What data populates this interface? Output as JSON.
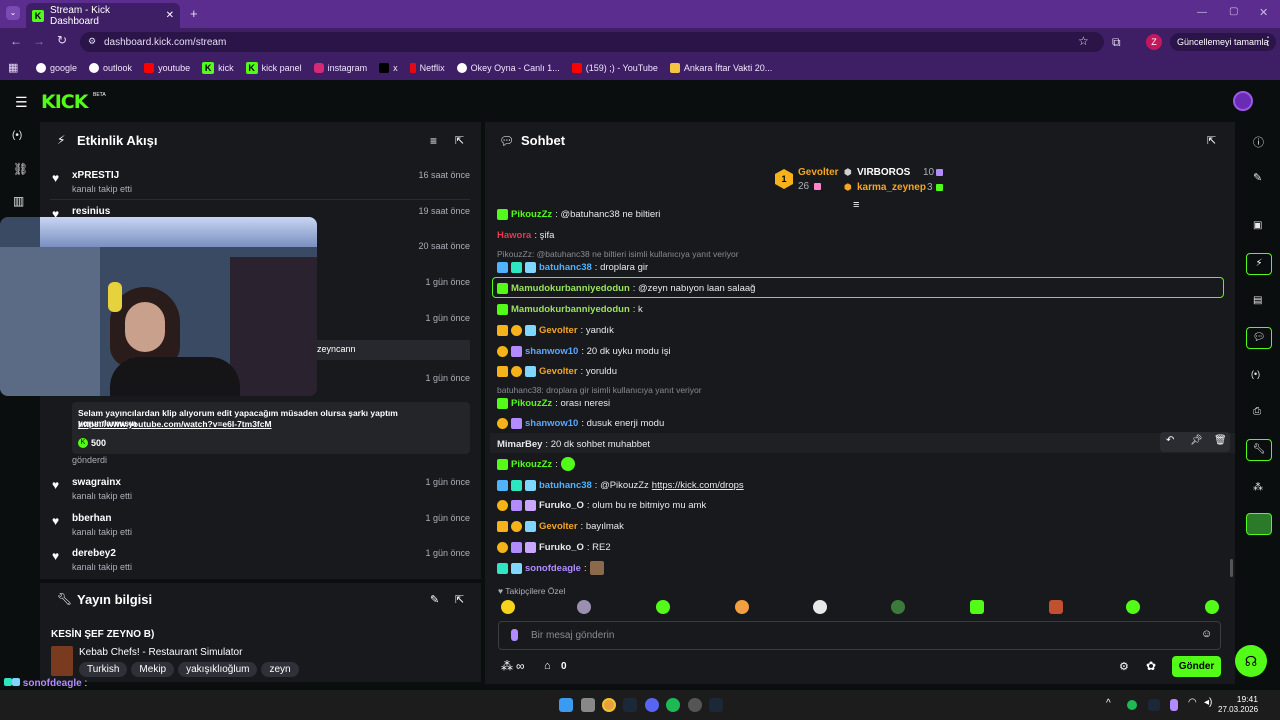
{
  "browser": {
    "tab_title": "Stream - Kick Dashboard",
    "new_tab": "+",
    "url": "dashboard.kick.com/stream",
    "update_button": "Güncellemeyi tamamla",
    "profile": "Z",
    "bookmarks": [
      "google",
      "outlook",
      "youtube",
      "kick",
      "kick panel",
      "instagram",
      "x",
      "Netflix",
      "Okey Oyna - Canlı 1...",
      "(159) ;) - YouTube",
      "Ankara İftar Vakti 20..."
    ]
  },
  "kick": {
    "logo": "KICK",
    "logo_beta": "BETA"
  },
  "activity": {
    "title": "Etkinlik Akışı",
    "items": [
      {
        "name": "xPRESTIJ",
        "sub": "kanalı takip etti",
        "time": "16 saat önce"
      },
      {
        "name": "resinius",
        "sub": "",
        "time": "19 saat önce"
      },
      {
        "name": "",
        "sub": "",
        "time": "20 saat önce"
      },
      {
        "name": "",
        "sub": "",
        "time": "1 gün önce"
      },
      {
        "name": "",
        "sub": "",
        "time": "1 gün önce"
      }
    ],
    "partial_name": "zeyncann",
    "tip_time": "1 gün önce",
    "tip_message": "Selam yayıncılardan klip alıyorum edit yapacağım müsaden olursa şarkı yaptım yorumlarmısın",
    "tip_link": "https://www.youtube.com/watch?v=e6I-7tm3fcM",
    "tip_amount": "500",
    "tip_status": "gönderdi",
    "items2": [
      {
        "name": "swagrainx",
        "sub": "kanalı takip etti",
        "time": "1 gün önce"
      },
      {
        "name": "bberhan",
        "sub": "kanalı takip etti",
        "time": "1 gün önce"
      },
      {
        "name": "derebey2",
        "sub": "kanalı takip etti",
        "time": "1 gün önce"
      }
    ]
  },
  "stream_info": {
    "title": "Yayın bilgisi",
    "stream_title": "KESİN ŞEF ZEYNO B)",
    "game": "Kebab Chefs! - Restaurant Simulator",
    "tags": [
      "Turkish",
      "Mekip",
      "yakışıklıoğlum",
      "zeyn"
    ]
  },
  "chat": {
    "title": "Sohbet",
    "leaderboard": {
      "first": {
        "rank": "1",
        "name": "Gevolter",
        "count": "26"
      },
      "second": {
        "name": "VIRBOROS",
        "count": "10"
      },
      "third": {
        "name": "karma_zeynep",
        "count": "3"
      }
    },
    "messages": [
      {
        "user": "PikouzZz",
        "color": "#53fc18",
        "text": ": @batuhanc38 ne biltieri"
      },
      {
        "user": "Hawora",
        "color": "#e5394d",
        "text": ": şifa"
      },
      {
        "user": "batuhanc38",
        "color": "#4fb3ff",
        "text": ": droplara gir"
      },
      {
        "user": "Mamudokurbanniyedodun",
        "color": "#9be35a",
        "text": ": @zeyn nabıyon laan salaağ"
      },
      {
        "user": "Mamudokurbanniyedodun",
        "color": "#9be35a",
        "text": ": k"
      },
      {
        "user": "Gevolter",
        "color": "#f5a623",
        "text": ": yandık"
      },
      {
        "user": "shanwow10",
        "color": "#5aa7ff",
        "text": ": 20 dk uyku modu işi"
      },
      {
        "user": "Gevolter",
        "color": "#f5a623",
        "text": ": yoruldu"
      },
      {
        "user": "PikouzZz",
        "color": "#53fc18",
        "text": ": orası neresi"
      },
      {
        "user": "shanwow10",
        "color": "#5aa7ff",
        "text": ": dusuk enerji modu"
      },
      {
        "user": "MimarBey",
        "color": "#e7e9ea",
        "text": ": 20 dk sohbet muhabbet"
      },
      {
        "user": "PikouzZz",
        "color": "#53fc18",
        "text": ":"
      },
      {
        "user": "batuhanc38",
        "color": "#4fb3ff",
        "text": ": @PikouzZz "
      },
      {
        "user": "Furuko_O",
        "color": "#e7e9ea",
        "text": ": olum bu re bitmiyo mu amk"
      },
      {
        "user": "Gevolter",
        "color": "#f5a623",
        "text": ": bayılmak"
      },
      {
        "user": "Furuko_O",
        "color": "#e7e9ea",
        "text": ": RE2"
      },
      {
        "user": "sonofdeagle",
        "color": "#b28cff",
        "text": ":"
      }
    ],
    "reply1": "PikouzZz: @batuhanc38 ne biltieri isimli kullanıcıya yanıt veriyor",
    "reply2": "batuhanc38: droplara gir isimli kullanıcıya yanıt veriyor",
    "drops_link": "https://kick.com/drops",
    "followers_only": "Takipçilere Özel",
    "input_placeholder": "Bir mesaj gönderin",
    "infinity": "∞",
    "store_count": "0",
    "send": "Gönder"
  },
  "overlay_user": "sonofdeagle",
  "clock": {
    "time": "19:41",
    "date": "27.03.2026"
  }
}
